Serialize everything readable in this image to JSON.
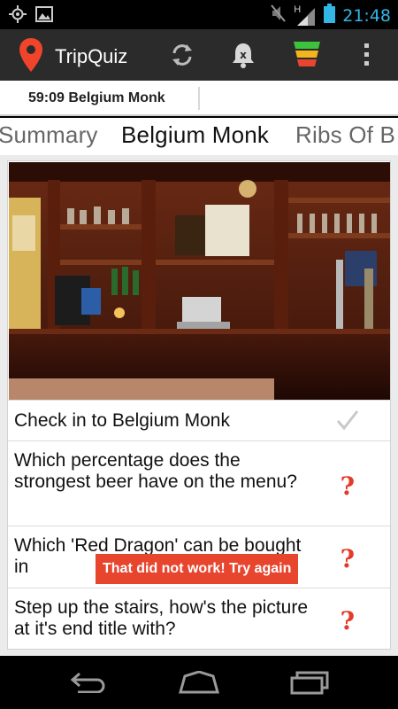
{
  "status_bar": {
    "time": "21:48",
    "icons": [
      "gps-icon",
      "image-icon",
      "mute-icon",
      "signal-icon",
      "battery-icon"
    ],
    "network_label": "H"
  },
  "action_bar": {
    "app_title": "TripQuiz",
    "icons": [
      "map-pin-icon",
      "refresh-icon",
      "bell-off-icon",
      "level-indicator-icon",
      "overflow-menu-icon"
    ],
    "accent": "#f0452b"
  },
  "timer": {
    "label": "59:09 Belgium Monk"
  },
  "tabs": [
    {
      "label": "Summary"
    },
    {
      "label": "Belgium Monk"
    },
    {
      "label": "Ribs Of B"
    }
  ],
  "questions": [
    {
      "text": "Check in to Belgium Monk",
      "status": "done",
      "status_icon": "checkmark-icon"
    },
    {
      "text": "Which percentage does the strongest beer have on the menu?",
      "status": "unanswered",
      "status_icon": "question-icon"
    },
    {
      "text": "Which 'Red Dragon' can be bought in",
      "status": "unanswered",
      "status_icon": "question-icon"
    },
    {
      "text": "Step up the stairs, how's the picture at it's end title with?",
      "status": "unanswered",
      "status_icon": "question-icon"
    }
  ],
  "question_glyph": "?",
  "toast": {
    "text": "That did not work! Try again",
    "color": "#e8452f"
  },
  "nav_bar": {
    "icons": [
      "back-icon",
      "home-icon",
      "recents-icon"
    ]
  }
}
